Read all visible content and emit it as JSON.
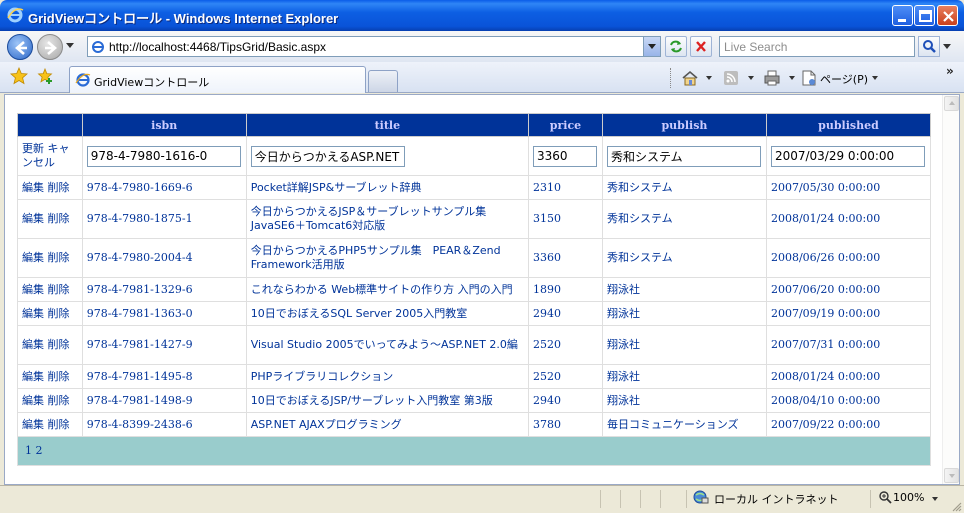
{
  "window": {
    "title": "GridViewコントロール - Windows Internet Explorer"
  },
  "address": {
    "url": "http://localhost:4468/TipsGrid/Basic.aspx"
  },
  "search": {
    "placeholder": "Live Search"
  },
  "tab": {
    "label": "GridViewコントロール"
  },
  "commands": {
    "page_label": "ページ(P)"
  },
  "grid": {
    "columns": [
      "isbn",
      "title",
      "price",
      "publish",
      "published"
    ],
    "edit_row": {
      "update_label": "更新",
      "cancel_label": "キャンセル",
      "isbn": "978-4-7980-1616-0",
      "title": "今日からつかえるASP.NET",
      "price": "3360",
      "publish": "秀和システム",
      "published": "2007/03/29 0:00:00"
    },
    "edit_label": "編集",
    "delete_label": "削除",
    "rows": [
      {
        "isbn": "978-4-7980-1669-6",
        "title": "Pocket詳解JSP&サーブレット辞典",
        "price": "2310",
        "publish": "秀和システム",
        "published": "2007/05/30 0:00:00"
      },
      {
        "isbn": "978-4-7980-1875-1",
        "title": "今日からつかえるJSP＆サーブレットサンプル集 JavaSE6＋Tomcat6対応版",
        "price": "3150",
        "publish": "秀和システム",
        "published": "2008/01/24 0:00:00"
      },
      {
        "isbn": "978-4-7980-2004-4",
        "title": "今日からつかえるPHP5サンプル集　PEAR＆Zend Framework活用版",
        "price": "3360",
        "publish": "秀和システム",
        "published": "2008/06/26 0:00:00"
      },
      {
        "isbn": "978-4-7981-1329-6",
        "title": "これならわかる Web標準サイトの作り方 入門の入門",
        "price": "1890",
        "publish": "翔泳社",
        "published": "2007/06/20 0:00:00"
      },
      {
        "isbn": "978-4-7981-1363-0",
        "title": "10日でおぼえるSQL Server 2005入門教室",
        "price": "2940",
        "publish": "翔泳社",
        "published": "2007/09/19 0:00:00"
      },
      {
        "isbn": "978-4-7981-1427-9",
        "title": "Visual Studio 2005でいってみよう～ASP.NET 2.0編",
        "price": "2520",
        "publish": "翔泳社",
        "published": "2007/07/31 0:00:00"
      },
      {
        "isbn": "978-4-7981-1495-8",
        "title": "PHPライブラリコレクション",
        "price": "2520",
        "publish": "翔泳社",
        "published": "2008/01/24 0:00:00"
      },
      {
        "isbn": "978-4-7981-1498-9",
        "title": "10日でおぼえるJSP/サーブレット入門教室 第3版",
        "price": "2940",
        "publish": "翔泳社",
        "published": "2008/04/10 0:00:00"
      },
      {
        "isbn": "978-4-8399-2438-6",
        "title": "ASP.NET AJAXプログラミング",
        "price": "3780",
        "publish": "毎日コミュニケーションズ",
        "published": "2007/09/22 0:00:00"
      }
    ],
    "pager": [
      "1",
      "2"
    ]
  },
  "status": {
    "zone": "ローカル イントラネット",
    "zoom": "100%"
  },
  "colors": {
    "header_bg": "#003399",
    "header_text": "#ccccff",
    "cell_text": "#003399",
    "pager_bg": "#99cccc"
  }
}
